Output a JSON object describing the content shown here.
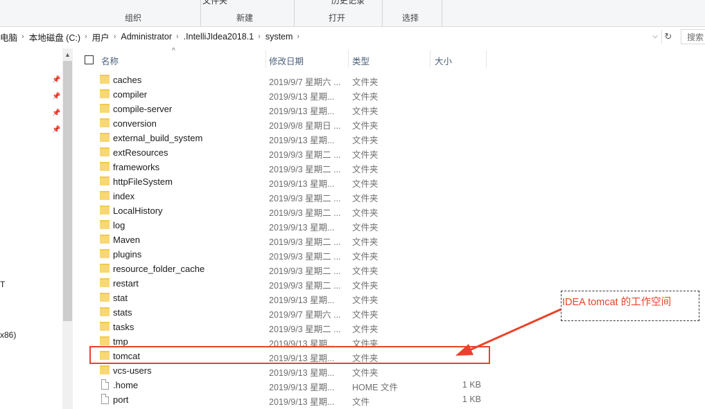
{
  "ribbon": {
    "top_texts": [
      "文件夹",
      "历史记录"
    ],
    "groups": [
      {
        "label": "组织"
      },
      {
        "label": "新建"
      },
      {
        "label": "打开"
      },
      {
        "label": "选择"
      }
    ]
  },
  "address_bar": {
    "crumbs": [
      "电脑",
      "本地磁盘 (C:)",
      "用户",
      "Administrator",
      ".IntelliJIdea2018.1",
      "system"
    ],
    "separator": "›",
    "dropdown_glyph": "⌵",
    "refresh_glyph": "↻"
  },
  "search": {
    "placeholder": "搜索"
  },
  "nav_pane": {
    "pin_glyph": "📌",
    "texts": [
      "T",
      "x86)"
    ]
  },
  "scroll_up_glyph": "▲",
  "columns": {
    "name": "名称",
    "date": "修改日期",
    "type": "类型",
    "size": "大小",
    "sort_glyph": "^"
  },
  "files": [
    {
      "name": "caches",
      "date": "2019/9/7 星期六 ...",
      "type": "文件夹",
      "size": "",
      "icon": "folder"
    },
    {
      "name": "compiler",
      "date": "2019/9/13 星期...",
      "type": "文件夹",
      "size": "",
      "icon": "folder"
    },
    {
      "name": "compile-server",
      "date": "2019/9/13 星期...",
      "type": "文件夹",
      "size": "",
      "icon": "folder"
    },
    {
      "name": "conversion",
      "date": "2019/9/8 星期日 ...",
      "type": "文件夹",
      "size": "",
      "icon": "folder"
    },
    {
      "name": "external_build_system",
      "date": "2019/9/13 星期...",
      "type": "文件夹",
      "size": "",
      "icon": "folder"
    },
    {
      "name": "extResources",
      "date": "2019/9/3 星期二 ...",
      "type": "文件夹",
      "size": "",
      "icon": "folder"
    },
    {
      "name": "frameworks",
      "date": "2019/9/3 星期二 ...",
      "type": "文件夹",
      "size": "",
      "icon": "folder"
    },
    {
      "name": "httpFileSystem",
      "date": "2019/9/13 星期...",
      "type": "文件夹",
      "size": "",
      "icon": "folder"
    },
    {
      "name": "index",
      "date": "2019/9/3 星期二 ...",
      "type": "文件夹",
      "size": "",
      "icon": "folder"
    },
    {
      "name": "LocalHistory",
      "date": "2019/9/3 星期二 ...",
      "type": "文件夹",
      "size": "",
      "icon": "folder"
    },
    {
      "name": "log",
      "date": "2019/9/13 星期...",
      "type": "文件夹",
      "size": "",
      "icon": "folder"
    },
    {
      "name": "Maven",
      "date": "2019/9/3 星期二 ...",
      "type": "文件夹",
      "size": "",
      "icon": "folder"
    },
    {
      "name": "plugins",
      "date": "2019/9/3 星期二 ...",
      "type": "文件夹",
      "size": "",
      "icon": "folder"
    },
    {
      "name": "resource_folder_cache",
      "date": "2019/9/3 星期二 ...",
      "type": "文件夹",
      "size": "",
      "icon": "folder"
    },
    {
      "name": "restart",
      "date": "2019/9/3 星期二 ...",
      "type": "文件夹",
      "size": "",
      "icon": "folder"
    },
    {
      "name": "stat",
      "date": "2019/9/13 星期...",
      "type": "文件夹",
      "size": "",
      "icon": "folder"
    },
    {
      "name": "stats",
      "date": "2019/9/7 星期六 ...",
      "type": "文件夹",
      "size": "",
      "icon": "folder"
    },
    {
      "name": "tasks",
      "date": "2019/9/3 星期二 ...",
      "type": "文件夹",
      "size": "",
      "icon": "folder"
    },
    {
      "name": "tmp",
      "date": "2019/9/13 星期...",
      "type": "文件夹",
      "size": "",
      "icon": "folder"
    },
    {
      "name": "tomcat",
      "date": "2019/9/13 星期...",
      "type": "文件夹",
      "size": "",
      "icon": "folder"
    },
    {
      "name": "vcs-users",
      "date": "2019/9/13 星期...",
      "type": "文件夹",
      "size": "",
      "icon": "folder"
    },
    {
      "name": ".home",
      "date": "2019/9/13 星期...",
      "type": "HOME 文件",
      "size": "1 KB",
      "icon": "file"
    },
    {
      "name": "port",
      "date": "2019/9/13 星期...",
      "type": "文件",
      "size": "1 KB",
      "icon": "file"
    }
  ],
  "annotation": {
    "text": "IDEA  tomcat  的工作空间",
    "color": "#e8432a"
  }
}
